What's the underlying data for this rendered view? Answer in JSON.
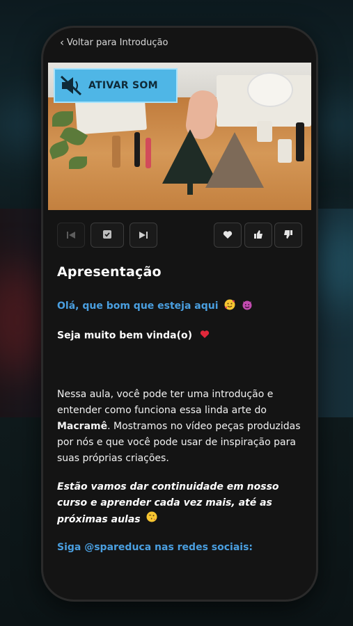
{
  "nav": {
    "back_label": "Voltar para Introdução"
  },
  "video": {
    "sound_button_label": "ATIVAR SOM"
  },
  "lesson": {
    "title": "Apresentação",
    "greeting": "Olá, que bom que esteja aqui",
    "welcome": "Seja muito bem vinda(o)",
    "para_part1": "Nessa aula, você pode ter uma introdução e entender como funciona essa linda arte do ",
    "para_bold": "Macramê",
    "para_part2": ". Mostramos no vídeo peças produzidas por nós e que você pode usar de inspiração para suas próprias criações.",
    "closing": "Estão vamos dar continuidade em nosso curso e aprender cada vez mais, até as próximas aulas",
    "follow": "Siga @spareduca nas redes sociais:"
  },
  "colors": {
    "accent": "#4a9fe0",
    "sound_button": "#4fb6e6",
    "heart": "#e0283a"
  },
  "icons": [
    "chevron-left-icon",
    "muted-speaker-icon",
    "skip-back-icon",
    "checkbox-icon",
    "skip-forward-icon",
    "heart-icon",
    "thumbs-up-icon",
    "thumbs-down-icon"
  ]
}
